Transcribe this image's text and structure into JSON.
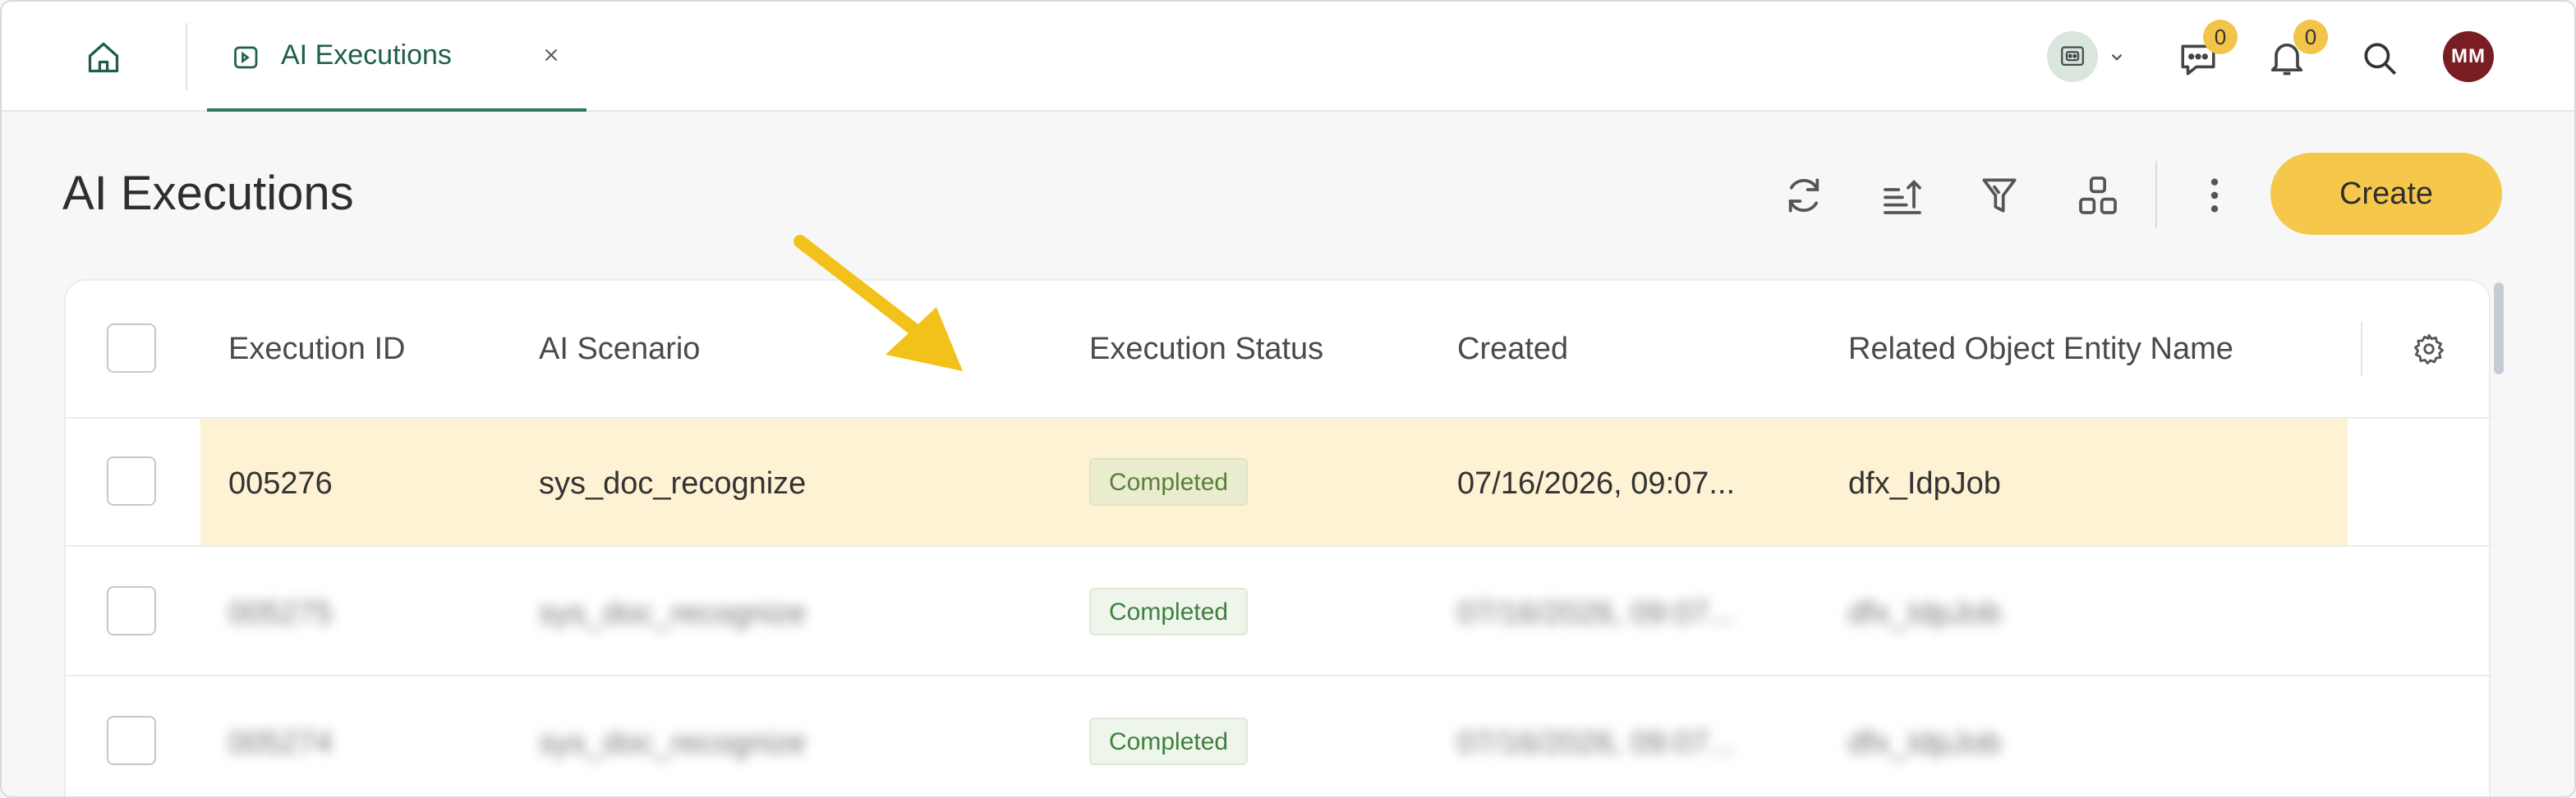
{
  "topbar": {
    "tab_label": "AI Executions",
    "chat_count": "0",
    "notification_count": "0",
    "avatar_initials": "MM"
  },
  "page": {
    "title": "AI Executions",
    "create_label": "Create"
  },
  "table": {
    "columns": [
      "Execution ID",
      "AI Scenario",
      "Execution Status",
      "Created",
      "Related Object Entity Name"
    ],
    "rows": [
      {
        "id": "005276",
        "scenario": "sys_doc_recognize",
        "status": "Completed",
        "created": "07/16/2026, 09:07...",
        "related": "dfx_IdpJob"
      },
      {
        "id": "005275",
        "scenario": "sys_doc_recognize",
        "status": "Completed",
        "created": "07/16/2026, 09:07...",
        "related": "dfx_IdpJob"
      },
      {
        "id": "005274",
        "scenario": "sys_doc_recognize",
        "status": "Completed",
        "created": "07/16/2026, 09:07...",
        "related": "dfx_IdpJob"
      }
    ]
  },
  "icons": {
    "home": "home-icon",
    "tab": "ai-execution-icon",
    "close": "close-icon",
    "bot": "bot-icon",
    "chat": "chat-icon",
    "bell": "bell-icon",
    "search": "search-icon",
    "refresh": "refresh-icon",
    "sort": "sort-icon",
    "filter": "filter-icon",
    "group": "group-icon",
    "more": "more-icon",
    "settings": "gear-icon"
  },
  "colors": {
    "accent": "#2f7a5e",
    "create": "#f5c84c",
    "badge": "#f2c44a",
    "avatar": "#7a1d22",
    "highlight": "#fdf2d3",
    "arrow": "#f2c21b"
  }
}
